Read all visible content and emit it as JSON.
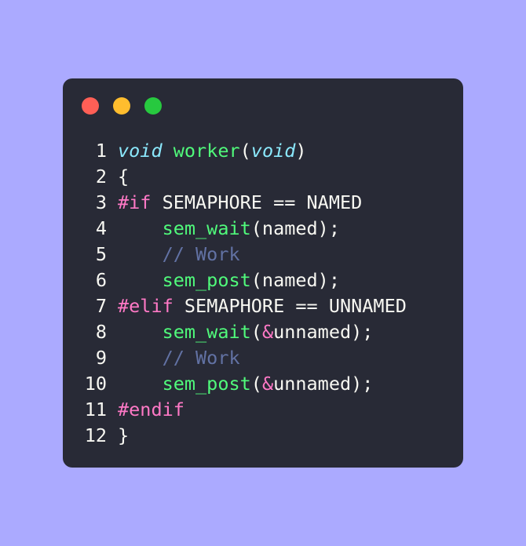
{
  "colors": {
    "background": "#abaaff",
    "window": "#282a36",
    "dot_close": "#ff5f56",
    "dot_minimize": "#ffbd2e",
    "dot_maximize": "#27c93f",
    "text": "#f8f8f2",
    "type": "#8be9fd",
    "function": "#50fa7b",
    "directive": "#ff79c6",
    "comment": "#6272a4"
  },
  "window_controls": [
    "close",
    "minimize",
    "maximize"
  ],
  "code": {
    "language": "c",
    "lines": [
      {
        "number": "1",
        "tokens": [
          {
            "type": "type",
            "text": "void"
          },
          {
            "type": "plain",
            "text": " "
          },
          {
            "type": "func",
            "text": "worker"
          },
          {
            "type": "plain",
            "text": "("
          },
          {
            "type": "type",
            "text": "void"
          },
          {
            "type": "plain",
            "text": ")"
          }
        ]
      },
      {
        "number": "2",
        "tokens": [
          {
            "type": "plain",
            "text": "{"
          }
        ]
      },
      {
        "number": "3",
        "tokens": [
          {
            "type": "directive",
            "text": "#if"
          },
          {
            "type": "plain",
            "text": " SEMAPHORE == NAMED"
          }
        ]
      },
      {
        "number": "4",
        "tokens": [
          {
            "type": "plain",
            "text": "    "
          },
          {
            "type": "func",
            "text": "sem_wait"
          },
          {
            "type": "plain",
            "text": "(named);"
          }
        ]
      },
      {
        "number": "5",
        "tokens": [
          {
            "type": "plain",
            "text": "    "
          },
          {
            "type": "comment",
            "text": "// Work"
          }
        ]
      },
      {
        "number": "6",
        "tokens": [
          {
            "type": "plain",
            "text": "    "
          },
          {
            "type": "func",
            "text": "sem_post"
          },
          {
            "type": "plain",
            "text": "(named);"
          }
        ]
      },
      {
        "number": "7",
        "tokens": [
          {
            "type": "directive",
            "text": "#elif"
          },
          {
            "type": "plain",
            "text": " SEMAPHORE == UNNAMED"
          }
        ]
      },
      {
        "number": "8",
        "tokens": [
          {
            "type": "plain",
            "text": "    "
          },
          {
            "type": "func",
            "text": "sem_wait"
          },
          {
            "type": "plain",
            "text": "("
          },
          {
            "type": "op",
            "text": "&"
          },
          {
            "type": "plain",
            "text": "unnamed);"
          }
        ]
      },
      {
        "number": "9",
        "tokens": [
          {
            "type": "plain",
            "text": "    "
          },
          {
            "type": "comment",
            "text": "// Work"
          }
        ]
      },
      {
        "number": "10",
        "tokens": [
          {
            "type": "plain",
            "text": "    "
          },
          {
            "type": "func",
            "text": "sem_post"
          },
          {
            "type": "plain",
            "text": "("
          },
          {
            "type": "op",
            "text": "&"
          },
          {
            "type": "plain",
            "text": "unnamed);"
          }
        ]
      },
      {
        "number": "11",
        "tokens": [
          {
            "type": "directive",
            "text": "#endif"
          }
        ]
      },
      {
        "number": "12",
        "tokens": [
          {
            "type": "plain",
            "text": "}"
          }
        ]
      }
    ]
  }
}
